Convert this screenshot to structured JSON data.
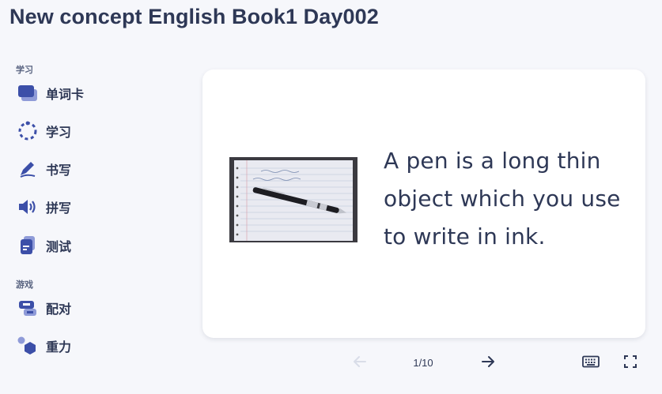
{
  "page": {
    "title": "New concept English Book1 Day002"
  },
  "sidebar": {
    "sections": [
      {
        "label": "学习"
      },
      {
        "label": "游戏"
      }
    ],
    "items": [
      {
        "label": "单词卡",
        "icon": "flashcards-icon"
      },
      {
        "label": "学习",
        "icon": "learn-icon"
      },
      {
        "label": "书写",
        "icon": "write-icon"
      },
      {
        "label": "拼写",
        "icon": "spell-icon"
      },
      {
        "label": "测试",
        "icon": "test-icon"
      },
      {
        "label": "配对",
        "icon": "match-icon"
      },
      {
        "label": "重力",
        "icon": "gravity-icon"
      }
    ]
  },
  "card": {
    "text": "A pen is a long thin object which you use to write in ink.",
    "image_alt": "pen on notebook photo"
  },
  "controls": {
    "counter": "1/10",
    "prev_icon": "arrow-left-icon",
    "next_icon": "arrow-right-icon",
    "keyboard_icon": "keyboard-icon",
    "fullscreen_icon": "fullscreen-icon"
  },
  "colors": {
    "background": "#f6f7fb",
    "card": "#ffffff",
    "accent": "#4255ff",
    "icon_primary": "#3c4fa8",
    "text": "#2e3856",
    "disabled": "#d9dde8"
  }
}
